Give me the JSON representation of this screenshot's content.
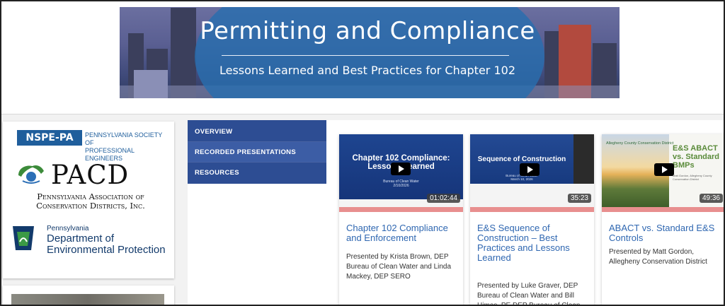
{
  "banner": {
    "title": "Permitting and Compliance",
    "subtitle": "Lessons Learned and Best Practices for Chapter 102"
  },
  "logos": {
    "nspe_abbrev": "NSPE-PA",
    "nspe_name_line1": "PENNSYLVANIA SOCIETY OF",
    "nspe_name_line2": "PROFESSIONAL ENGINEERS",
    "pacd_abbrev": "PACD",
    "pacd_line1": "Pennsylvania Association of",
    "pacd_line2": "Conservation Districts, Inc.",
    "dep_state": "Pennsylvania",
    "dep_line1": "Department of",
    "dep_line2": "Environmental Protection"
  },
  "nav": {
    "items": [
      {
        "label": "OVERVIEW",
        "active": false
      },
      {
        "label": "RECORDED PRESENTATIONS",
        "active": true
      },
      {
        "label": "RESOURCES",
        "active": false
      }
    ]
  },
  "videos": [
    {
      "slide_title_line1": "Chapter 102 Compliance:",
      "slide_title_line2": "Lessons Learned",
      "slide_sub1": "Bureau of Clean Water",
      "slide_sub2": "2/10/2026",
      "duration": "01:02:44",
      "title": "Chapter 102 Compliance and Enforcement",
      "description": "Presented by Krista Brown, DEP Bureau of Clean Water and Linda Mackey, DEP SERO"
    },
    {
      "slide_title": "Sequence of Construction",
      "slide_sub1": "Bureau of Clean Water",
      "slide_sub2": "March 10, 2026",
      "duration": "35:23",
      "title": "E&S Sequence of Construction – Best Practices and Lessons Learned",
      "description": "Presented by Luke Graver, DEP Bureau of Clean Water and Bill Himes, PE DEP Bureau of Clean Water"
    },
    {
      "slide_logo": "Allegheny County Conservation District",
      "slide_title": "E&S ABACT vs. Standard BMPs",
      "slide_small": "Matt Gordon, Allegheny County Conservation District",
      "duration": "49:36",
      "title": "ABACT vs. Standard E&S Controls",
      "description": "Presented by Matt Gordon, Allegheny Conservation District"
    }
  ],
  "colors": {
    "nav_bg": "#2d4d93",
    "link": "#2f67b1",
    "accent_bar": "#e88f8f"
  }
}
